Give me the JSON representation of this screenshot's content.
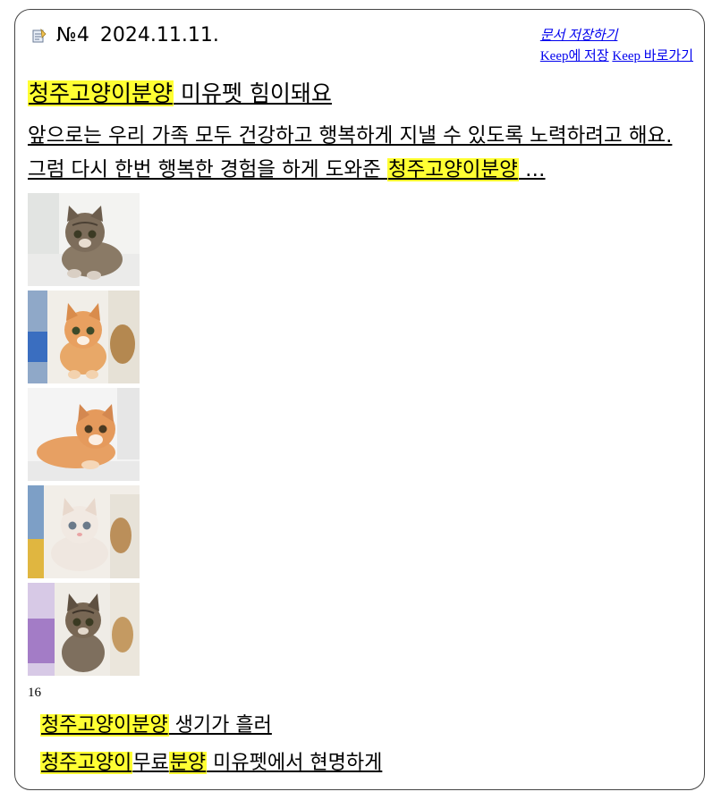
{
  "result": {
    "number": "№4",
    "date": "2024.11.11.",
    "actions": {
      "save_doc": "문서 저장하기",
      "keep_save": "Keep에 저장",
      "keep_go": "Keep 바로가기"
    },
    "title": {
      "highlight": "청주고양이분양",
      "rest": " 미유펫 힘이돼요"
    },
    "snippet": {
      "text": "앞으로는 우리 가족 모두 건강하고 행복하게 지낼 수 있도록 노력하려고 해요. 그럼 다시 한번 행복한 경험을 하게 도와준 ",
      "highlight": "청주고양이분양",
      "tail": " …"
    },
    "images": [
      {
        "icon": "tabby-kitten-photo",
        "color": "#8a7a66"
      },
      {
        "icon": "orange-kitten-photo",
        "color": "#e8a868"
      },
      {
        "icon": "orange-kitten-lying-photo",
        "color": "#e7a063"
      },
      {
        "icon": "white-kitten-photo",
        "color": "#efe7e0"
      },
      {
        "icon": "tabby-kitten-sitting-photo",
        "color": "#7e6f5e"
      }
    ],
    "image_count": "16"
  },
  "related": [
    {
      "parts": [
        {
          "text": "청주고양이분양",
          "hl": true
        },
        {
          "text": " 생기가 흘러",
          "hl": false
        }
      ]
    },
    {
      "parts": [
        {
          "text": "청주고양이",
          "hl": true
        },
        {
          "text": "무료",
          "hl": false
        },
        {
          "text": "분양",
          "hl": true
        },
        {
          "text": " 미유펫에서 현명하게",
          "hl": false
        }
      ]
    }
  ],
  "colors": {
    "highlight": "#ffff33",
    "link": "#0000ee"
  }
}
